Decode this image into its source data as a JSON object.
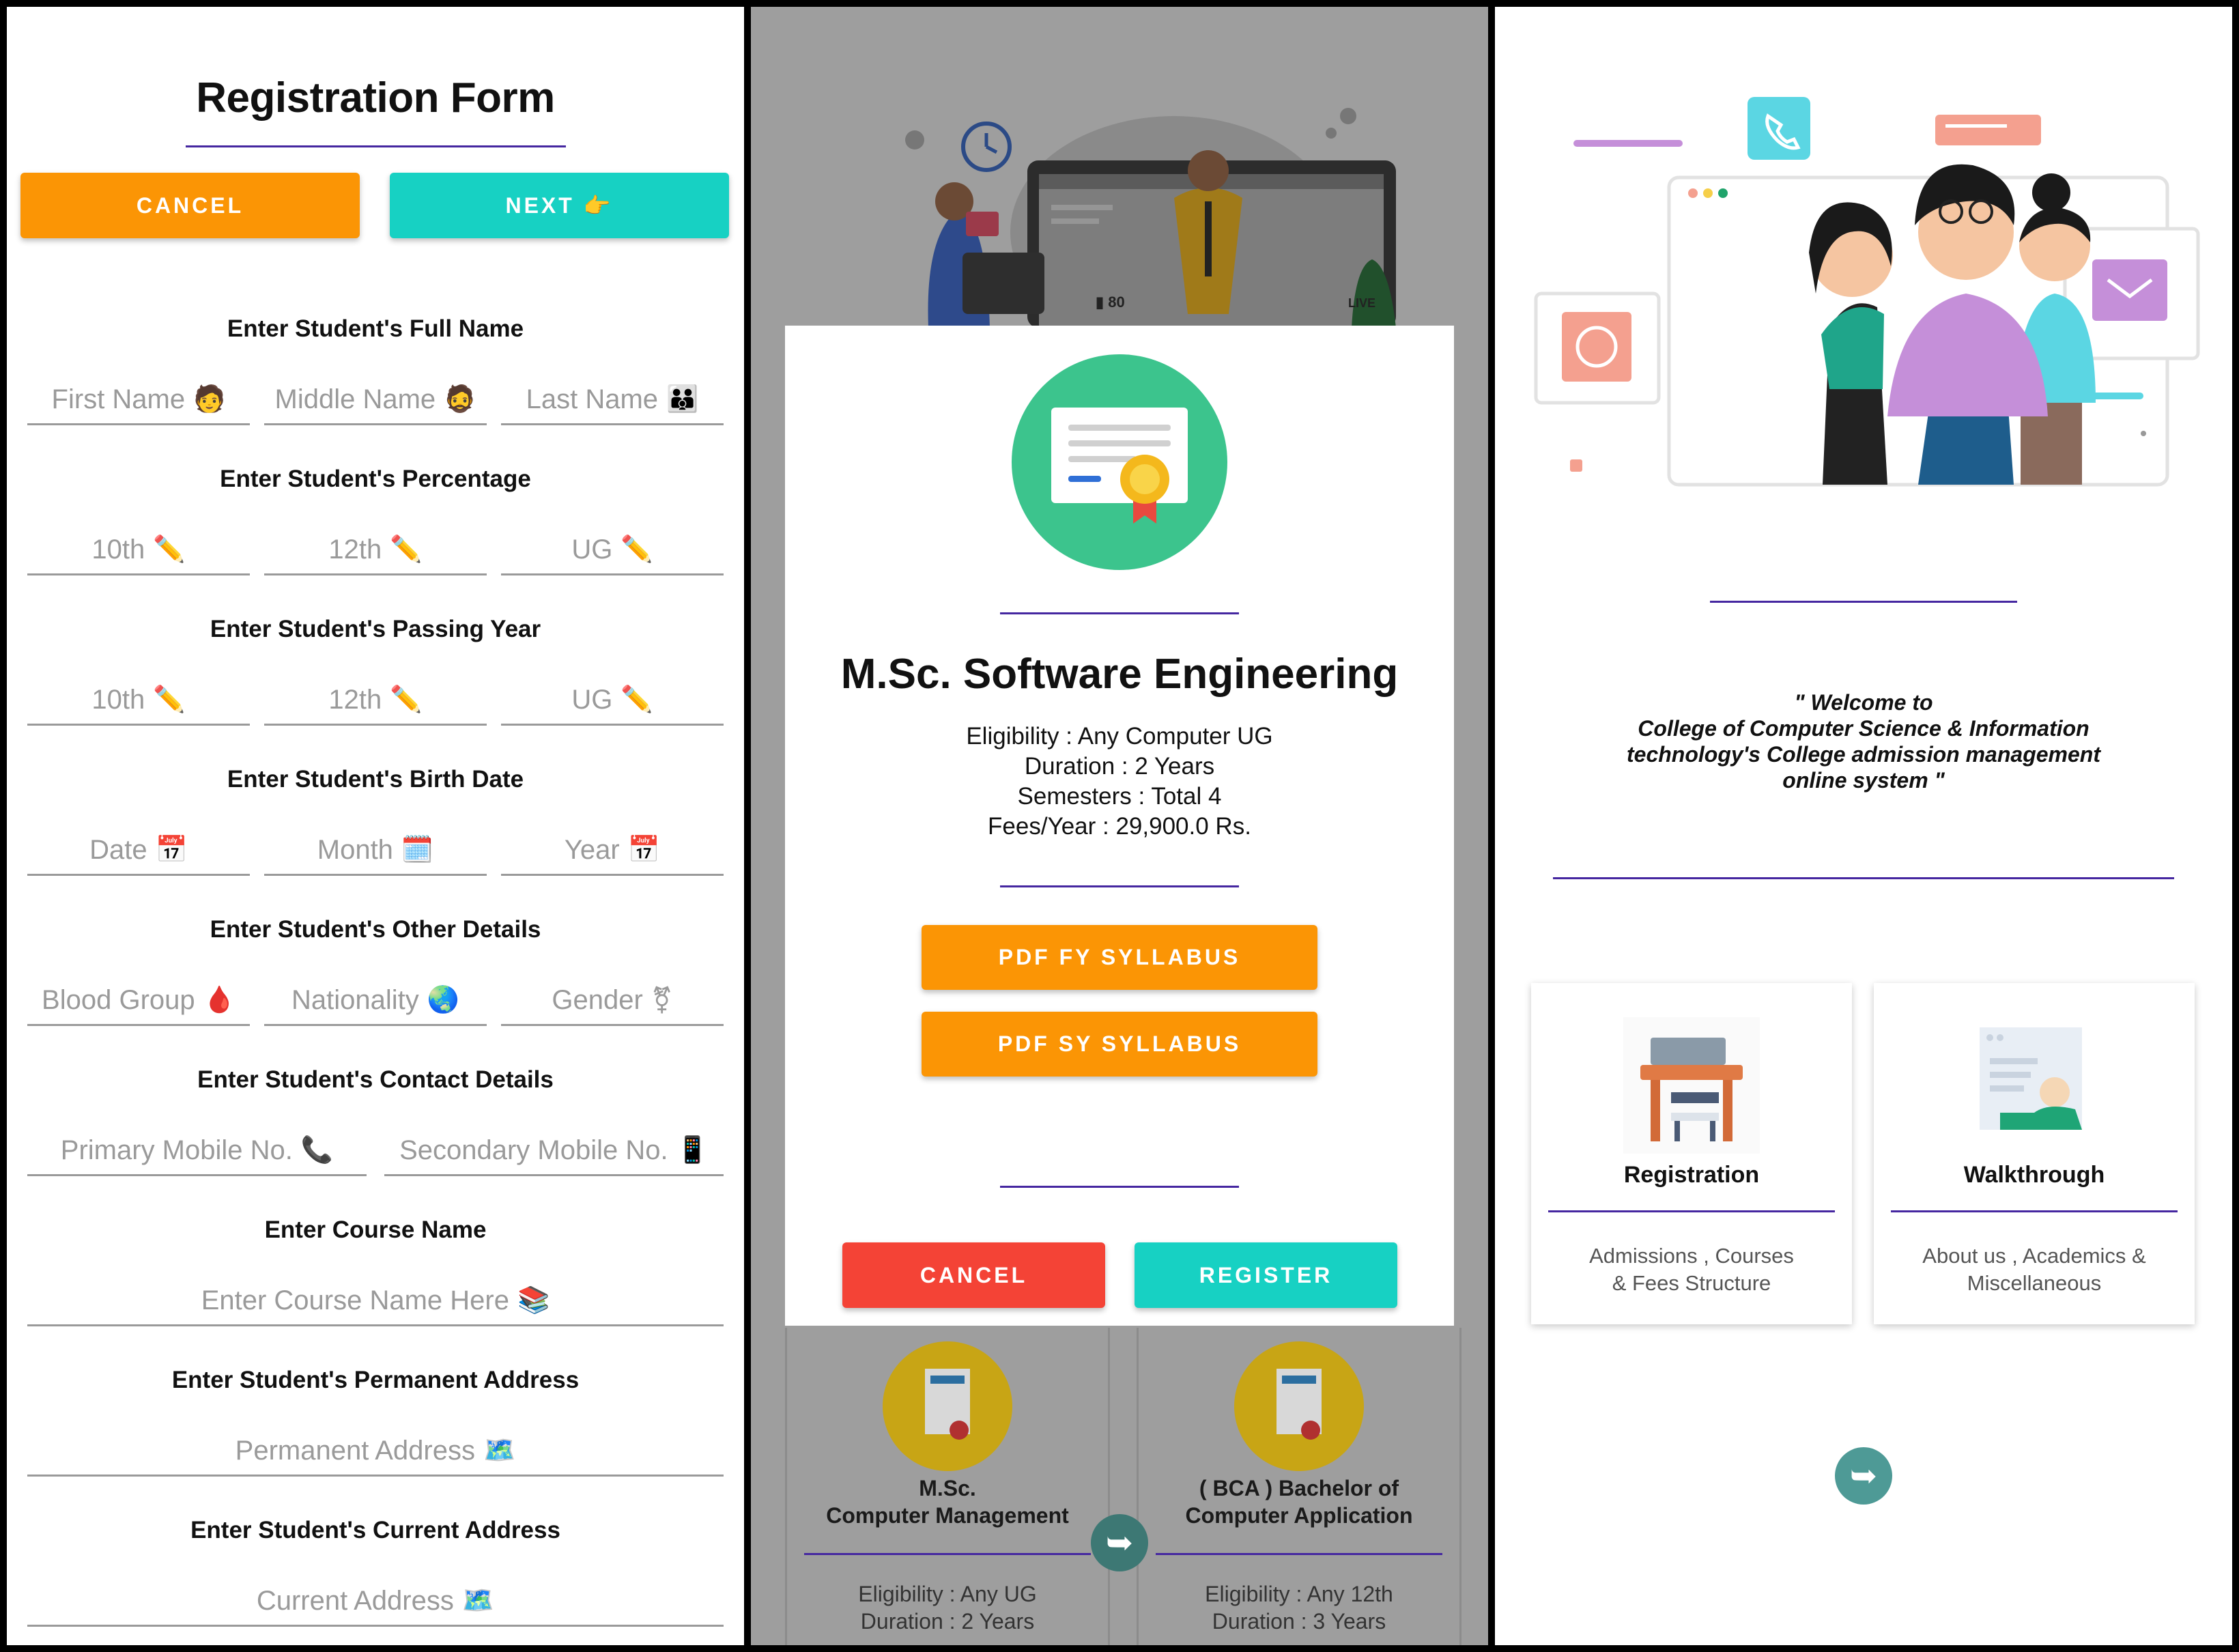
{
  "form": {
    "title": "Registration Form",
    "cancel_label": "CANCEL",
    "next_label": "NEXT 👉",
    "sections": [
      {
        "heading": "Enter Student's Full Name",
        "fields": [
          {
            "placeholder": "First Name",
            "icon": "🧑"
          },
          {
            "placeholder": "Middle Name",
            "icon": "🧔"
          },
          {
            "placeholder": "Last Name",
            "icon": "👪"
          }
        ]
      },
      {
        "heading": "Enter Student's Percentage",
        "fields": [
          {
            "placeholder": "10th",
            "icon": "✏️"
          },
          {
            "placeholder": "12th",
            "icon": "✏️"
          },
          {
            "placeholder": "UG",
            "icon": "✏️"
          }
        ]
      },
      {
        "heading": "Enter Student's Passing Year",
        "fields": [
          {
            "placeholder": "10th",
            "icon": "✏️"
          },
          {
            "placeholder": "12th",
            "icon": "✏️"
          },
          {
            "placeholder": "UG",
            "icon": "✏️"
          }
        ]
      },
      {
        "heading": "Enter Student's Birth Date",
        "fields": [
          {
            "placeholder": "Date",
            "icon": "📅"
          },
          {
            "placeholder": "Month",
            "icon": "🗓️"
          },
          {
            "placeholder": "Year",
            "icon": "📅"
          }
        ]
      },
      {
        "heading": "Enter Student's Other Details",
        "fields": [
          {
            "placeholder": "Blood Group",
            "icon": "🩸"
          },
          {
            "placeholder": "Nationality",
            "icon": "🌏"
          },
          {
            "placeholder": "Gender",
            "icon": "⚧"
          }
        ]
      },
      {
        "heading": "Enter Student's Contact Details",
        "fields": [
          {
            "placeholder": "Primary Mobile No.",
            "icon": "📞"
          },
          {
            "placeholder": "Secondary Mobile No.",
            "icon": "📱"
          }
        ]
      },
      {
        "heading": "Enter Course Name",
        "fields": [
          {
            "placeholder": "Enter Course Name Here",
            "icon": "📚"
          }
        ]
      },
      {
        "heading": "Enter Student's Permanent Address",
        "fields": [
          {
            "placeholder": "Permanent Address",
            "icon": "🗺️"
          }
        ]
      },
      {
        "heading": "Enter Student's Current Address",
        "fields": [
          {
            "placeholder": "Current Address",
            "icon": "🗺️"
          }
        ]
      }
    ]
  },
  "course_dialog": {
    "title": "M.Sc. Software Engineering",
    "lines": [
      "Eligibility : Any Computer UG",
      "Duration : 2 Years",
      "Semesters : Total 4",
      "Fees/Year : 29,900.0 Rs."
    ],
    "pdf_fy_label": "PDF FY SYLLABUS",
    "pdf_sy_label": "PDF SY SYLLABUS",
    "cancel_label": "CANCEL",
    "register_label": "REGISTER",
    "live_badge": "LIVE",
    "viewer_count": "80"
  },
  "background_courses": [
    {
      "title_line1": "M.Sc.",
      "title_line2": "Computer Management",
      "eligibility": "Eligibility : Any UG",
      "duration": "Duration : 2 Years"
    },
    {
      "title_line1": "( BCA ) Bachelor of",
      "title_line2": "Computer Application",
      "eligibility": "Eligibility : Any 12th",
      "duration": "Duration : 3 Years"
    }
  ],
  "home": {
    "welcome_lines": [
      "\" Welcome to",
      "College of Computer Science & Information",
      "technology's College admission management",
      "online system \""
    ],
    "cards": [
      {
        "title": "Registration",
        "desc1": "Admissions , Courses",
        "desc2": "& Fees Structure"
      },
      {
        "title": "Walkthrough",
        "desc1": "About us , Academics &",
        "desc2": "Miscellaneous"
      }
    ]
  },
  "colors": {
    "accent_orange": "#fb9505",
    "accent_teal": "#17d1c3",
    "danger_red": "#f44336",
    "underline_purple": "#4527a0",
    "back_button": "#4e9a96"
  }
}
